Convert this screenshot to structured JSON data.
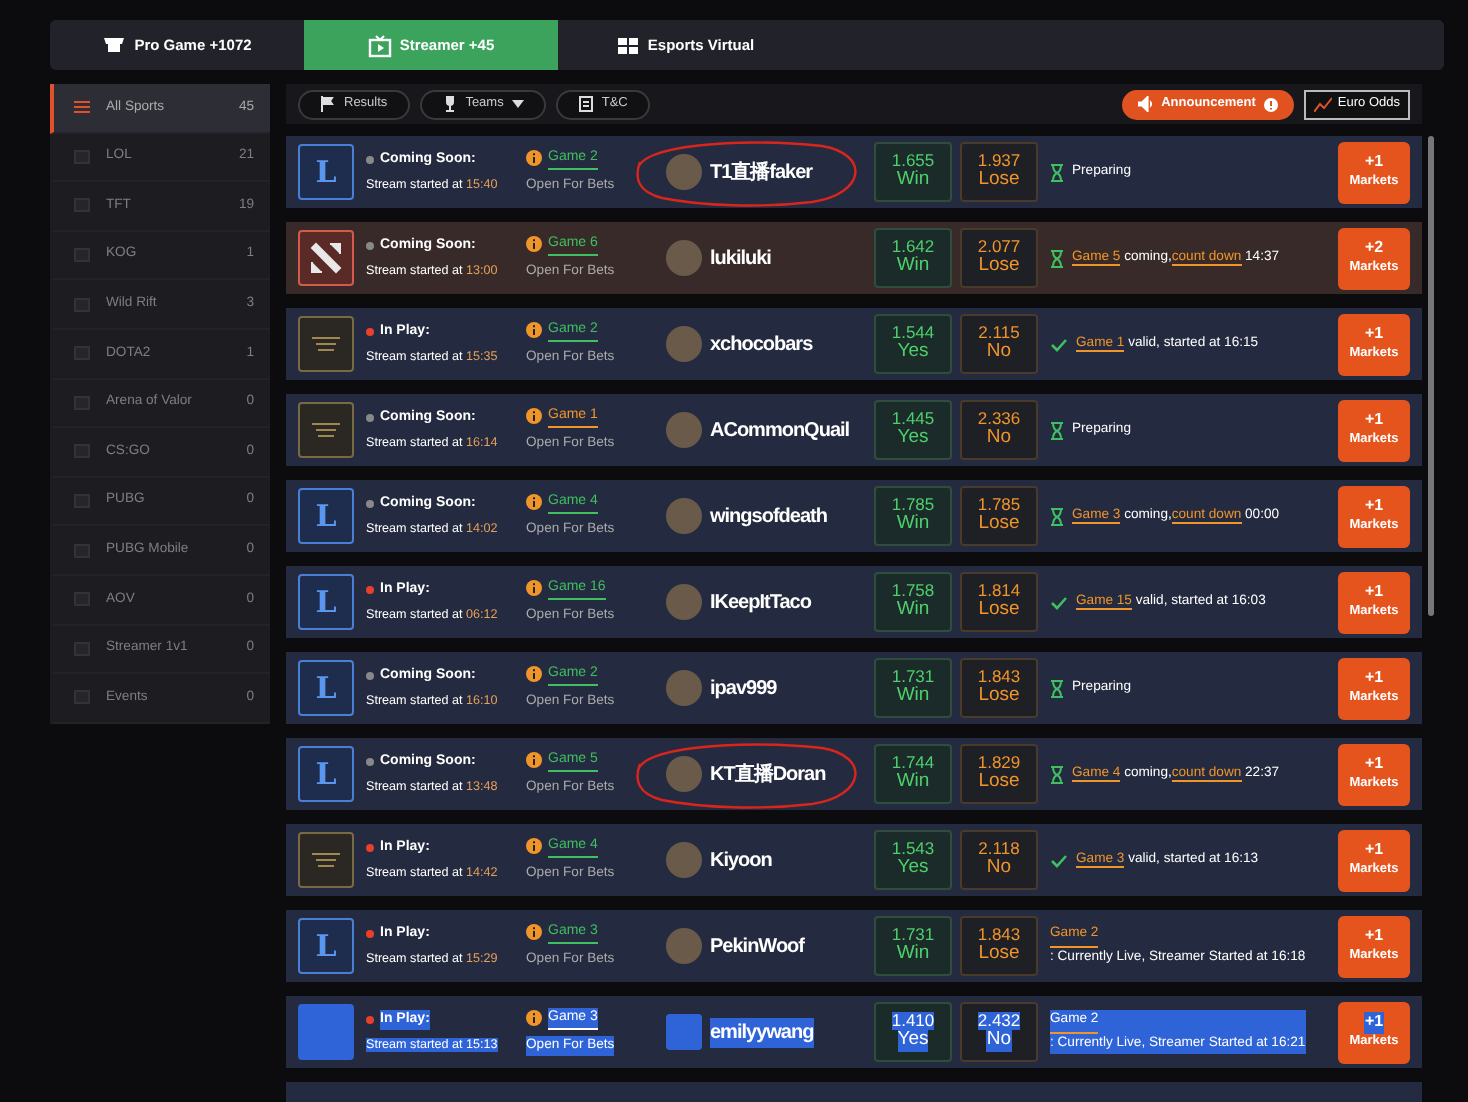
{
  "top_tabs": [
    {
      "label": "Pro Game +1072",
      "selected": false
    },
    {
      "label": "Streamer +45",
      "selected": true
    },
    {
      "label": "Esports Virtual",
      "selected": false
    }
  ],
  "sidebar": {
    "items": [
      {
        "label": "All Sports",
        "count": "45",
        "selected": true
      },
      {
        "label": "LOL",
        "count": "21",
        "selected": false
      },
      {
        "label": "TFT",
        "count": "19",
        "selected": false
      },
      {
        "label": "KOG",
        "count": "1",
        "selected": false
      },
      {
        "label": "Wild Rift",
        "count": "3",
        "selected": false
      },
      {
        "label": "DOTA2",
        "count": "1",
        "selected": false
      },
      {
        "label": "Arena of Valor",
        "count": "0",
        "selected": false
      },
      {
        "label": "CS:GO",
        "count": "0",
        "selected": false
      },
      {
        "label": "PUBG",
        "count": "0",
        "selected": false
      },
      {
        "label": "PUBG Mobile",
        "count": "0",
        "selected": false
      },
      {
        "label": "AOV",
        "count": "0",
        "selected": false
      },
      {
        "label": "Streamer 1v1",
        "count": "0",
        "selected": false
      },
      {
        "label": "Events",
        "count": "0",
        "selected": false
      }
    ]
  },
  "toolbar": {
    "buttons": [
      {
        "label": "Results"
      },
      {
        "label": "Teams",
        "kind": "dropdown"
      },
      {
        "label": "T&C"
      }
    ],
    "announcement": "Announcement",
    "odds_format": "Euro Odds"
  },
  "matches": [
    {
      "logo": {
        "kind": "lol",
        "letter": "L"
      },
      "state": {
        "kind": "coming",
        "label": "Coming Soon:"
      },
      "started_label": "Stream started at",
      "started_time": "15:40",
      "game": {
        "label": "Game 2",
        "color": "#3fbf5f"
      },
      "bets": "Open For Bets",
      "streamer": "T1直播faker",
      "odds": [
        {
          "value": "1.655",
          "label": "Win"
        },
        {
          "value": "1.937",
          "label": "Lose"
        }
      ],
      "status": {
        "kind": "preparing",
        "parts": [
          {
            "text": "Preparing",
            "link": false
          }
        ]
      },
      "markets": {
        "count": "+1",
        "label": "Markets"
      },
      "circled": true,
      "text_selected": false
    },
    {
      "logo": {
        "kind": "dota"
      },
      "state": {
        "kind": "coming",
        "label": "Coming Soon:"
      },
      "started_label": "Stream started at",
      "started_time": "13:00",
      "game": {
        "label": "Game 6",
        "color": "#3fbf5f"
      },
      "bets": "Open For Bets",
      "streamer": "lukiluki",
      "odds": [
        {
          "value": "1.642",
          "label": "Win"
        },
        {
          "value": "2.077",
          "label": "Lose"
        }
      ],
      "status": {
        "kind": "countdown",
        "parts": [
          {
            "text": "Game 5",
            "link": true
          },
          {
            "text": " coming,",
            "link": false
          },
          {
            "text": "count down",
            "link": true
          },
          {
            "text": " 14:37",
            "link": false
          }
        ]
      },
      "markets": {
        "count": "+2",
        "label": "Markets"
      },
      "circled": false,
      "text_selected": false
    },
    {
      "logo": {
        "kind": "brand"
      },
      "state": {
        "kind": "live",
        "label": "In Play:"
      },
      "started_label": "Stream started at",
      "started_time": "15:35",
      "game": {
        "label": "Game 2",
        "color": "#3fbf5f"
      },
      "bets": "Open For Bets",
      "streamer": "xchocobars",
      "odds": [
        {
          "value": "1.544",
          "label": "Yes"
        },
        {
          "value": "2.115",
          "label": "No"
        }
      ],
      "status": {
        "kind": "valid",
        "parts": [
          {
            "text": "Game 1",
            "link": true
          },
          {
            "text": " valid, started at 16:15",
            "link": false
          }
        ]
      },
      "markets": {
        "count": "+1",
        "label": "Markets"
      },
      "circled": false,
      "text_selected": false
    },
    {
      "logo": {
        "kind": "brand"
      },
      "state": {
        "kind": "coming",
        "label": "Coming Soon:"
      },
      "started_label": "Stream started at",
      "started_time": "16:14",
      "game": {
        "label": "Game 1",
        "color": "#f0952a"
      },
      "bets": "Open For Bets",
      "streamer": "ACommonQuail",
      "odds": [
        {
          "value": "1.445",
          "label": "Yes"
        },
        {
          "value": "2.336",
          "label": "No"
        }
      ],
      "status": {
        "kind": "preparing",
        "parts": [
          {
            "text": "Preparing",
            "link": false
          }
        ]
      },
      "markets": {
        "count": "+1",
        "label": "Markets"
      },
      "circled": false,
      "text_selected": false
    },
    {
      "logo": {
        "kind": "lol",
        "letter": "L"
      },
      "state": {
        "kind": "coming",
        "label": "Coming Soon:"
      },
      "started_label": "Stream started at",
      "started_time": "14:02",
      "game": {
        "label": "Game 4",
        "color": "#3fbf5f"
      },
      "bets": "Open For Bets",
      "streamer": "wingsofdeath",
      "odds": [
        {
          "value": "1.785",
          "label": "Win"
        },
        {
          "value": "1.785",
          "label": "Lose"
        }
      ],
      "status": {
        "kind": "countdown",
        "parts": [
          {
            "text": "Game 3",
            "link": true
          },
          {
            "text": " coming,",
            "link": false
          },
          {
            "text": "count down",
            "link": true
          },
          {
            "text": " 00:00",
            "link": false
          }
        ]
      },
      "markets": {
        "count": "+1",
        "label": "Markets"
      },
      "circled": false,
      "text_selected": false
    },
    {
      "logo": {
        "kind": "lol",
        "letter": "L"
      },
      "state": {
        "kind": "live",
        "label": "In Play:"
      },
      "started_label": "Stream started at",
      "started_time": "06:12",
      "game": {
        "label": "Game 16",
        "color": "#3fbf5f"
      },
      "bets": "Open For Bets",
      "streamer": "IKeepItTaco",
      "odds": [
        {
          "value": "1.758",
          "label": "Win"
        },
        {
          "value": "1.814",
          "label": "Lose"
        }
      ],
      "status": {
        "kind": "valid",
        "parts": [
          {
            "text": "Game 15",
            "link": true
          },
          {
            "text": " valid, started at 16:03",
            "link": false
          }
        ]
      },
      "markets": {
        "count": "+1",
        "label": "Markets"
      },
      "circled": false,
      "text_selected": false
    },
    {
      "logo": {
        "kind": "lol",
        "letter": "L"
      },
      "state": {
        "kind": "coming",
        "label": "Coming Soon:"
      },
      "started_label": "Stream started at",
      "started_time": "16:10",
      "game": {
        "label": "Game 2",
        "color": "#3fbf5f"
      },
      "bets": "Open For Bets",
      "streamer": "ipav999",
      "odds": [
        {
          "value": "1.731",
          "label": "Win"
        },
        {
          "value": "1.843",
          "label": "Lose"
        }
      ],
      "status": {
        "kind": "preparing",
        "parts": [
          {
            "text": "Preparing",
            "link": false
          }
        ]
      },
      "markets": {
        "count": "+1",
        "label": "Markets"
      },
      "circled": false,
      "text_selected": false
    },
    {
      "logo": {
        "kind": "lol",
        "letter": "L"
      },
      "state": {
        "kind": "coming",
        "label": "Coming Soon:"
      },
      "started_label": "Stream started at",
      "started_time": "13:48",
      "game": {
        "label": "Game 5",
        "color": "#3fbf5f"
      },
      "bets": "Open For Bets",
      "streamer": "KT直播Doran",
      "odds": [
        {
          "value": "1.744",
          "label": "Win"
        },
        {
          "value": "1.829",
          "label": "Lose"
        }
      ],
      "status": {
        "kind": "countdown",
        "parts": [
          {
            "text": "Game 4",
            "link": true
          },
          {
            "text": " coming,",
            "link": false
          },
          {
            "text": "count down",
            "link": true
          },
          {
            "text": " 22:37",
            "link": false
          }
        ]
      },
      "markets": {
        "count": "+1",
        "label": "Markets"
      },
      "circled": true,
      "text_selected": false
    },
    {
      "logo": {
        "kind": "brand"
      },
      "state": {
        "kind": "live",
        "label": "In Play:"
      },
      "started_label": "Stream started at",
      "started_time": "14:42",
      "game": {
        "label": "Game 4",
        "color": "#3fbf5f"
      },
      "bets": "Open For Bets",
      "streamer": "Kiyoon",
      "odds": [
        {
          "value": "1.543",
          "label": "Yes"
        },
        {
          "value": "2.118",
          "label": "No"
        }
      ],
      "status": {
        "kind": "valid",
        "parts": [
          {
            "text": "Game 3",
            "link": true
          },
          {
            "text": " valid, started at 16:13",
            "link": false
          }
        ]
      },
      "markets": {
        "count": "+1",
        "label": "Markets"
      },
      "circled": false,
      "text_selected": false
    },
    {
      "logo": {
        "kind": "lol",
        "letter": "L"
      },
      "state": {
        "kind": "live",
        "label": "In Play:"
      },
      "started_label": "Stream started at",
      "started_time": "15:29",
      "game": {
        "label": "Game 3",
        "color": "#3fbf5f"
      },
      "bets": "Open For Bets",
      "streamer": "PekinWoof",
      "odds": [
        {
          "value": "1.731",
          "label": "Win"
        },
        {
          "value": "1.843",
          "label": "Lose"
        }
      ],
      "status": {
        "kind": "live",
        "parts": [
          {
            "text": "Game 2",
            "link": true,
            "line_break": true
          },
          {
            "text": ": Currently Live, Streamer Started at 16:18",
            "link": false
          }
        ]
      },
      "markets": {
        "count": "+1",
        "label": "Markets"
      },
      "circled": false,
      "text_selected": false
    },
    {
      "logo": {
        "kind": "brand"
      },
      "state": {
        "kind": "live",
        "label": "In Play:"
      },
      "started_label": "Stream started at",
      "started_time": "15:13",
      "game": {
        "label": "Game 3"
      },
      "bets": "Open For Bets",
      "streamer": "emilyywang",
      "odds": [
        {
          "value": "1.410",
          "label": "Yes"
        },
        {
          "value": "2.432",
          "label": "No"
        }
      ],
      "status": {
        "kind": "live",
        "parts": [
          {
            "text": "Game 2",
            "link": true,
            "line_break": true
          },
          {
            "text": ": Currently Live, Streamer Started at 16:21",
            "link": false
          }
        ]
      },
      "markets": {
        "count": "+1",
        "label": "Markets"
      },
      "circled": false,
      "text_selected": true
    }
  ]
}
